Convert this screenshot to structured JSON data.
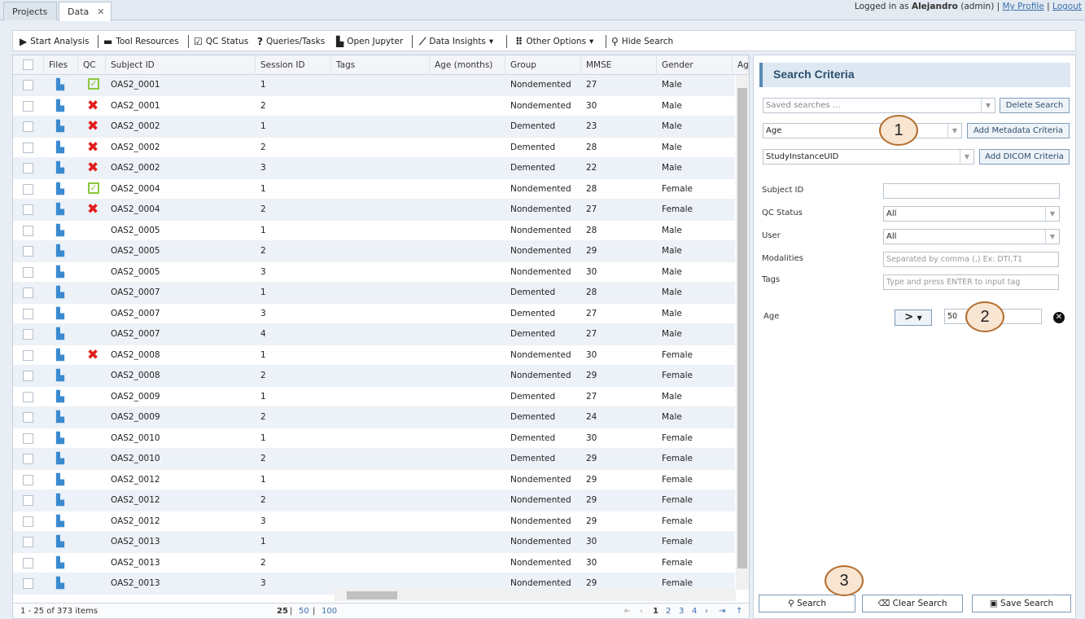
{
  "tabs": [
    {
      "label": "Projects"
    },
    {
      "label": "Data"
    }
  ],
  "user": {
    "prefix": "Logged in as",
    "name": "Alejandro",
    "role": "(admin)",
    "sep": "|",
    "profile": "My Profile",
    "logout": "Logout"
  },
  "toolbar": {
    "start_analysis": "Start Analysis",
    "tool_resources": "Tool Resources",
    "qc_status": "QC Status",
    "queries": "Queries/Tasks",
    "open_jupyter": "Open Jupyter",
    "data_insights": "Data Insights",
    "other_options": "Other Options",
    "hide_search": "Hide Search"
  },
  "columns": [
    "Files",
    "QC",
    "Subject ID",
    "Session ID",
    "Tags",
    "Age (months)",
    "Group",
    "MMSE",
    "Gender",
    "Ag"
  ],
  "rows": [
    {
      "qc": "ok",
      "subject": "OAS2_0001",
      "session": "1",
      "group": "Nondemented",
      "mmse": "27",
      "gender": "Male"
    },
    {
      "qc": "fail",
      "subject": "OAS2_0001",
      "session": "2",
      "group": "Nondemented",
      "mmse": "30",
      "gender": "Male"
    },
    {
      "qc": "fail",
      "subject": "OAS2_0002",
      "session": "1",
      "group": "Demented",
      "mmse": "23",
      "gender": "Male"
    },
    {
      "qc": "fail",
      "subject": "OAS2_0002",
      "session": "2",
      "group": "Demented",
      "mmse": "28",
      "gender": "Male"
    },
    {
      "qc": "fail",
      "subject": "OAS2_0002",
      "session": "3",
      "group": "Demented",
      "mmse": "22",
      "gender": "Male"
    },
    {
      "qc": "ok",
      "subject": "OAS2_0004",
      "session": "1",
      "group": "Nondemented",
      "mmse": "28",
      "gender": "Female"
    },
    {
      "qc": "fail",
      "subject": "OAS2_0004",
      "session": "2",
      "group": "Nondemented",
      "mmse": "27",
      "gender": "Female"
    },
    {
      "qc": "",
      "subject": "OAS2_0005",
      "session": "1",
      "group": "Nondemented",
      "mmse": "28",
      "gender": "Male"
    },
    {
      "qc": "",
      "subject": "OAS2_0005",
      "session": "2",
      "group": "Nondemented",
      "mmse": "29",
      "gender": "Male"
    },
    {
      "qc": "",
      "subject": "OAS2_0005",
      "session": "3",
      "group": "Nondemented",
      "mmse": "30",
      "gender": "Male"
    },
    {
      "qc": "",
      "subject": "OAS2_0007",
      "session": "1",
      "group": "Demented",
      "mmse": "28",
      "gender": "Male"
    },
    {
      "qc": "",
      "subject": "OAS2_0007",
      "session": "3",
      "group": "Demented",
      "mmse": "27",
      "gender": "Male"
    },
    {
      "qc": "",
      "subject": "OAS2_0007",
      "session": "4",
      "group": "Demented",
      "mmse": "27",
      "gender": "Male"
    },
    {
      "qc": "fail",
      "subject": "OAS2_0008",
      "session": "1",
      "group": "Nondemented",
      "mmse": "30",
      "gender": "Female"
    },
    {
      "qc": "",
      "subject": "OAS2_0008",
      "session": "2",
      "group": "Nondemented",
      "mmse": "29",
      "gender": "Female"
    },
    {
      "qc": "",
      "subject": "OAS2_0009",
      "session": "1",
      "group": "Demented",
      "mmse": "27",
      "gender": "Male"
    },
    {
      "qc": "",
      "subject": "OAS2_0009",
      "session": "2",
      "group": "Demented",
      "mmse": "24",
      "gender": "Male"
    },
    {
      "qc": "",
      "subject": "OAS2_0010",
      "session": "1",
      "group": "Demented",
      "mmse": "30",
      "gender": "Female"
    },
    {
      "qc": "",
      "subject": "OAS2_0010",
      "session": "2",
      "group": "Demented",
      "mmse": "29",
      "gender": "Female"
    },
    {
      "qc": "",
      "subject": "OAS2_0012",
      "session": "1",
      "group": "Nondemented",
      "mmse": "29",
      "gender": "Female"
    },
    {
      "qc": "",
      "subject": "OAS2_0012",
      "session": "2",
      "group": "Nondemented",
      "mmse": "29",
      "gender": "Female"
    },
    {
      "qc": "",
      "subject": "OAS2_0012",
      "session": "3",
      "group": "Nondemented",
      "mmse": "29",
      "gender": "Female"
    },
    {
      "qc": "",
      "subject": "OAS2_0013",
      "session": "1",
      "group": "Nondemented",
      "mmse": "30",
      "gender": "Female"
    },
    {
      "qc": "",
      "subject": "OAS2_0013",
      "session": "2",
      "group": "Nondemented",
      "mmse": "30",
      "gender": "Female"
    },
    {
      "qc": "",
      "subject": "OAS2_0013",
      "session": "3",
      "group": "Nondemented",
      "mmse": "29",
      "gender": "Female"
    }
  ],
  "pager": {
    "summary": "1 - 25 of 373 items",
    "size_25": "25",
    "size_50": "50",
    "size_100": "100",
    "pages": [
      "1",
      "2",
      "3",
      "4"
    ]
  },
  "search": {
    "title": "Search Criteria",
    "saved_placeholder": "Saved searches ...",
    "delete_label": "Delete Search",
    "metadata_value": "Age",
    "add_metadata_label": "Add Metadata Criteria",
    "dicom_value": "StudyInstanceUID",
    "add_dicom_label": "Add DICOM Criteria",
    "subject_label": "Subject ID",
    "qc_label": "QC Status",
    "qc_value": "All",
    "user_label": "User",
    "user_value": "All",
    "modalities_label": "Modalities",
    "modalities_placeholder": "Separated by comma (,) Ex: DTI,T1",
    "tags_label": "Tags",
    "tags_placeholder": "Type and press ENTER to input tag",
    "age_label": "Age",
    "age_operator": ">",
    "age_value": "50",
    "search_label": "Search",
    "clear_label": "Clear Search",
    "save_label": "Save Search"
  },
  "callouts": [
    "1",
    "2",
    "3"
  ],
  "colors": {
    "accent": "#5a89b5",
    "fail": "#e21c1c",
    "ok": "#8cc63f",
    "callout_border": "#b36d2c"
  }
}
